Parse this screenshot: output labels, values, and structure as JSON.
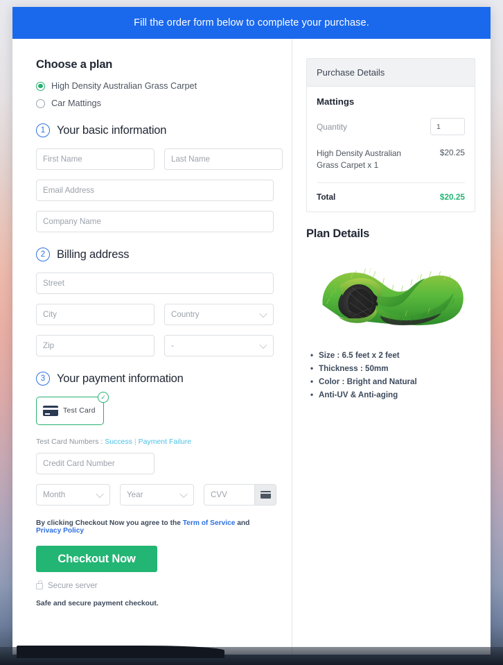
{
  "banner": {
    "message": "Fill the order form below to complete your purchase."
  },
  "plan_chooser": {
    "title": "Choose a plan",
    "options": [
      {
        "label": "High Density Australian Grass Carpet",
        "selected": true
      },
      {
        "label": "Car Mattings",
        "selected": false
      }
    ]
  },
  "steps": {
    "basic": {
      "number": "1",
      "title": "Your basic information"
    },
    "billing": {
      "number": "2",
      "title": "Billing address"
    },
    "payment": {
      "number": "3",
      "title": "Your payment information"
    }
  },
  "basic_fields": {
    "first_name": {
      "placeholder": "First Name",
      "value": ""
    },
    "last_name": {
      "placeholder": "Last Name",
      "value": ""
    },
    "email": {
      "placeholder": "Email Address",
      "value": ""
    },
    "company": {
      "placeholder": "Company Name",
      "value": ""
    }
  },
  "billing_fields": {
    "street": {
      "placeholder": "Street",
      "value": ""
    },
    "city": {
      "placeholder": "City",
      "value": ""
    },
    "country": {
      "placeholder": "Country",
      "value": ""
    },
    "zip": {
      "placeholder": "Zip",
      "value": ""
    },
    "state": {
      "placeholder": "-",
      "value": ""
    }
  },
  "payment": {
    "card_tile_label": "Test Card",
    "card_tile_selected": true,
    "test_card_prefix": "Test Card Numbers : ",
    "test_card_success": "Success",
    "test_card_separator": "|",
    "test_card_failure": "Payment Failure",
    "card_number": {
      "placeholder": "Credit Card Number",
      "value": ""
    },
    "month": {
      "placeholder": "Month",
      "value": ""
    },
    "year": {
      "placeholder": "Year",
      "value": ""
    },
    "cvv": {
      "placeholder": "CVV",
      "value": ""
    }
  },
  "terms": {
    "prefix": "By clicking Checkout Now you agree to the ",
    "tos": "Term of Service",
    "conjunction": " and ",
    "privacy": "Privacy Policy"
  },
  "checkout": {
    "button_label": "Checkout Now",
    "secure_server": "Secure server",
    "safe_note": "Safe and secure payment checkout."
  },
  "purchase_details": {
    "heading": "Purchase Details",
    "plan_name": "Mattings",
    "quantity_label": "Quantity",
    "quantity_value": "1",
    "line_item_name": "High Density Australian Grass Carpet x 1",
    "line_item_price": "$20.25",
    "total_label": "Total",
    "total_value": "$20.25"
  },
  "plan_details": {
    "heading": "Plan Details",
    "image_alt": "rolled artificial grass carpet",
    "specs": [
      "Size : 6.5 feet x 2 feet",
      "Thickness : 50mm",
      "Color : Bright and Natural",
      "Anti-UV & Anti-aging"
    ]
  },
  "colors": {
    "banner_blue": "#1a68ec",
    "accent_green": "#22b573",
    "step_blue": "#2f72e3",
    "link_blue": "#2d6fe0",
    "link_cyan": "#4cc0e4"
  }
}
